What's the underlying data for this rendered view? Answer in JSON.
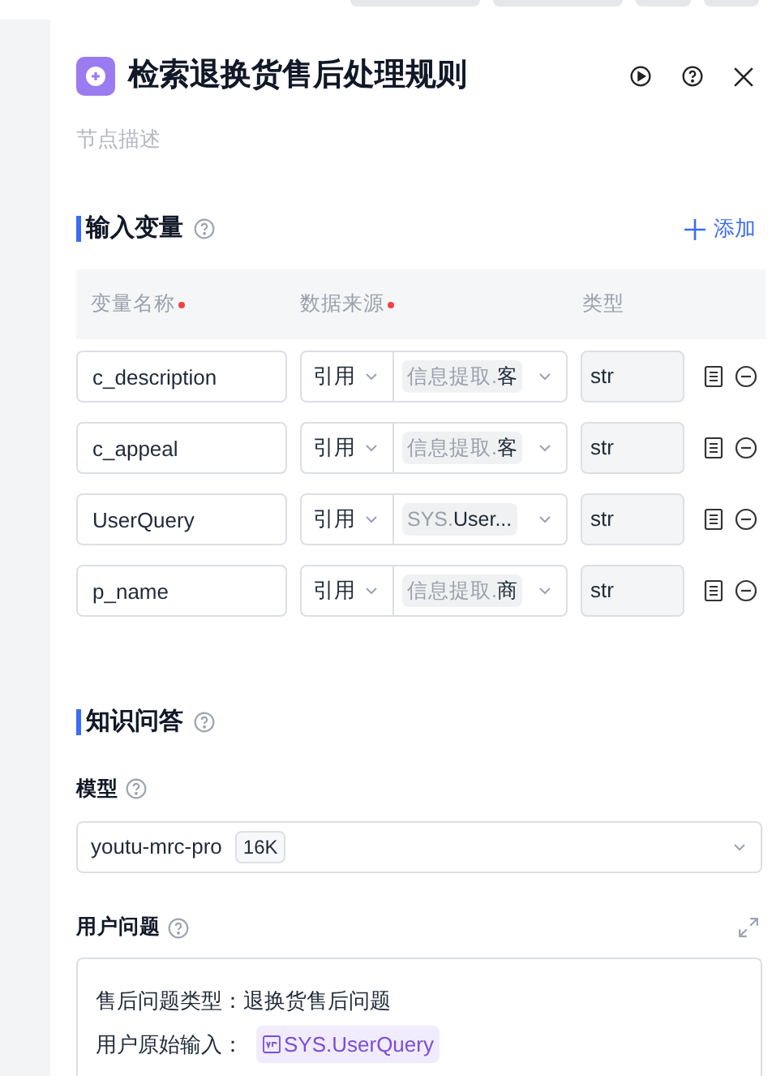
{
  "panel": {
    "title": "检索退换货售后处理规则",
    "description_placeholder": "节点描述"
  },
  "input_variables": {
    "title": "输入变量",
    "add_label": "添加",
    "columns": [
      {
        "label": "变量名称",
        "required": true
      },
      {
        "label": "数据来源",
        "required": true
      },
      {
        "label": "类型",
        "required": false
      }
    ],
    "rows": [
      {
        "name": "c_description",
        "source_mode": "引用",
        "source_prefix": "信息提取.",
        "source_value": "客",
        "type": "str"
      },
      {
        "name": "c_appeal",
        "source_mode": "引用",
        "source_prefix": "信息提取.",
        "source_value": "客",
        "type": "str"
      },
      {
        "name": "UserQuery",
        "source_mode": "引用",
        "source_prefix": "SYS.",
        "source_value": "User...",
        "type": "str"
      },
      {
        "name": "p_name",
        "source_mode": "引用",
        "source_prefix": "信息提取.",
        "source_value": "商",
        "type": "str"
      }
    ]
  },
  "knowledge_qa": {
    "title": "知识问答",
    "model_label": "模型",
    "model": "youtu-mrc-pro",
    "model_badge": "16K",
    "question_label": "用户问题",
    "question_lines": [
      {
        "label": "售后问题类型：",
        "text": "退换货售后问题"
      },
      {
        "label": "用户原始输入：",
        "variable": "SYS.UserQuery"
      }
    ]
  }
}
